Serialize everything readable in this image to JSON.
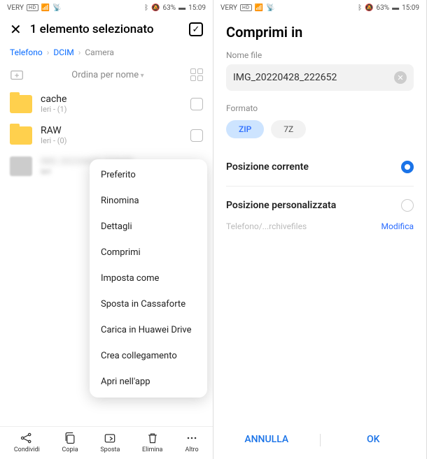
{
  "status": {
    "carrier": "VERY",
    "hd": "HD",
    "battery": "63%",
    "time": "15:09"
  },
  "left": {
    "title": "1 elemento selezionato",
    "breadcrumbs": [
      "Telefono",
      "DCIM",
      "Camera"
    ],
    "sort_label": "Ordina per nome",
    "files": [
      {
        "name": "cache",
        "meta": "Ieri - (1)"
      },
      {
        "name": "RAW",
        "meta": "Ieri - (0)"
      }
    ],
    "blurred_name": "IMG 20220428 222652",
    "blurred_meta": "ieri",
    "menu": [
      "Preferito",
      "Rinomina",
      "Dettagli",
      "Comprimi",
      "Imposta come",
      "Sposta in Cassaforte",
      "Carica in Huawei Drive",
      "Crea collegamento",
      "Apri nell'app"
    ],
    "bottom": {
      "share": "Condividi",
      "copy": "Copia",
      "move": "Sposta",
      "delete": "Elimina",
      "more": "Altro"
    }
  },
  "right": {
    "title": "Comprimi in",
    "filename_label": "Nome file",
    "filename_value": "IMG_20220428_222652",
    "format_label": "Formato",
    "formats": {
      "zip": "ZIP",
      "sevenz": "7Z"
    },
    "pos_current": "Posizione corrente",
    "pos_custom": "Posizione personalizzata",
    "pos_path": "Telefono/...rchivefiles",
    "edit_label": "Modifica",
    "cancel": "ANNULLA",
    "ok": "OK"
  }
}
